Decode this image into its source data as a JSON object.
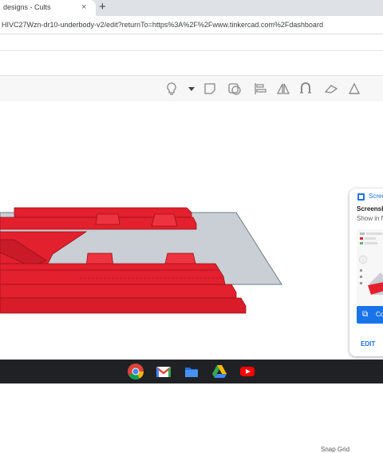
{
  "browser": {
    "tab_title": "designs - Cults",
    "tab_close": "×",
    "new_tab": "+",
    "url": "HIVC27Wzn-dr10-underbody-v2/edit?returnTo=https%3A%2F%2Fwww.tinkercad.com%2Fdashboard"
  },
  "toolbar": {
    "icons": [
      "lightbulb-icon",
      "dropdown-arrow-icon",
      "note-icon",
      "workplane-icon",
      "align-icon",
      "mirror-icon",
      "magnet-icon",
      "flip-icon",
      "ruler-icon"
    ]
  },
  "workplane": {
    "snap_grid_label": "Snap Grid",
    "plane_color": "#c9cfd4",
    "model_color": "#e3202e"
  },
  "notification": {
    "app_name": "Scree",
    "title": "Screensh",
    "subtitle": "Show in f",
    "copy_label": "Co",
    "edit_label": "EDIT"
  },
  "shelf": {
    "apps": [
      "chrome-icon",
      "gmail-icon",
      "files-icon",
      "google-drive-icon",
      "youtube-icon"
    ]
  }
}
